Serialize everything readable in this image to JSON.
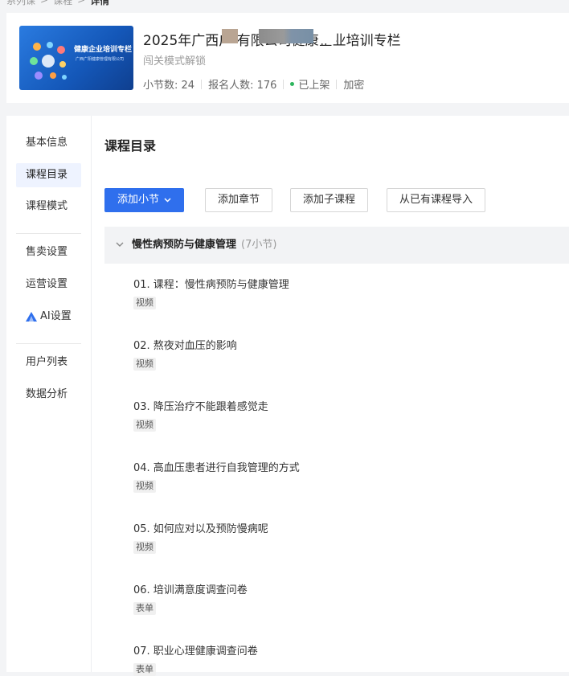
{
  "breadcrumb": {
    "items": [
      "系列课",
      "课程",
      "详情"
    ],
    "sep": ">"
  },
  "header": {
    "cover_title": "健康企业培训专栏",
    "cover_subtitle": "广西广阳健康管理有限公司",
    "title": "2025年广西广          有限公司健康企业培训专栏",
    "mode": "闯关模式解锁",
    "lessons_label": "小节数: 24",
    "signups_label": "报名人数: 176",
    "status": "已上架",
    "encrypted": "加密",
    "status_color": "#2db55d"
  },
  "sidebar": {
    "items": [
      {
        "label": "基本信息"
      },
      {
        "label": "课程目录"
      },
      {
        "label": "课程模式"
      },
      {
        "label": "售卖设置"
      },
      {
        "label": "运营设置"
      },
      {
        "label": "AI设置",
        "icon": "ai-triangle-icon"
      },
      {
        "label": "用户列表"
      },
      {
        "label": "数据分析"
      }
    ],
    "active": "课程目录"
  },
  "content": {
    "title": "课程目录",
    "buttons": {
      "add_lesson": "添加小节",
      "add_chapter": "添加章节",
      "add_subcourse": "添加子课程",
      "import": "从已有课程导入"
    },
    "chapter": {
      "title": "慢性病预防与健康管理",
      "count": "(7小节)"
    },
    "lessons": [
      {
        "title": "01. 课程：慢性病预防与健康管理",
        "type": "视频"
      },
      {
        "title": "02. 熬夜对血压的影响",
        "type": "视频"
      },
      {
        "title": "03. 降压治疗不能跟着感觉走",
        "type": "视频"
      },
      {
        "title": "04. 高血压患者进行自我管理的方式",
        "type": "视频"
      },
      {
        "title": "05. 如何应对以及预防慢病呢",
        "type": "视频"
      },
      {
        "title": "06. 培训满意度调查问卷",
        "type": "表单"
      },
      {
        "title": "07. 职业心理健康调查问卷",
        "type": "表单"
      }
    ]
  },
  "colors": {
    "primary": "#2f6fed",
    "active_nav_bg": "#eef3ff"
  }
}
